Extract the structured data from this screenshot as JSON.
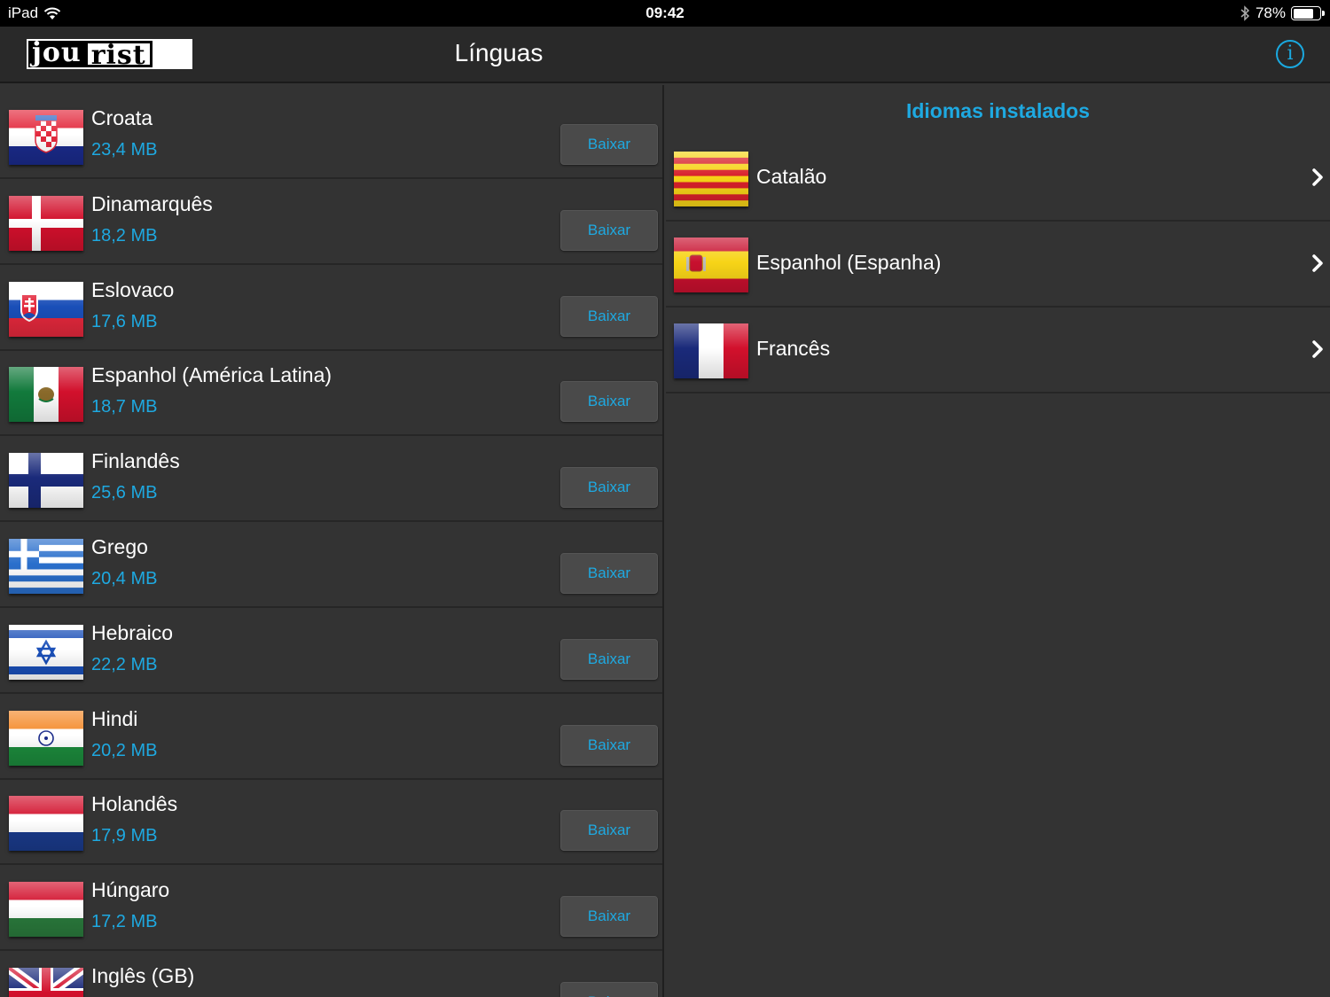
{
  "status_bar": {
    "device": "iPad",
    "time": "09:42",
    "battery": "78%",
    "battery_level": 0.78
  },
  "nav": {
    "logo_left": "jou",
    "logo_right": "rist",
    "title": "Línguas",
    "info_icon": "info-icon"
  },
  "available": {
    "button_label": "Baixar",
    "items": [
      {
        "name": "Croata",
        "size": "23,4 MB",
        "flag": "croatia"
      },
      {
        "name": "Dinamarquês",
        "size": "18,2 MB",
        "flag": "denmark"
      },
      {
        "name": "Eslovaco",
        "size": "17,6 MB",
        "flag": "slovakia"
      },
      {
        "name": "Espanhol (América Latina)",
        "size": "18,7 MB",
        "flag": "mexico"
      },
      {
        "name": "Finlandês",
        "size": "25,6 MB",
        "flag": "finland"
      },
      {
        "name": "Grego",
        "size": "20,4 MB",
        "flag": "greece"
      },
      {
        "name": "Hebraico",
        "size": "22,2 MB",
        "flag": "israel"
      },
      {
        "name": "Hindi",
        "size": "20,2 MB",
        "flag": "india"
      },
      {
        "name": "Holandês",
        "size": "17,9 MB",
        "flag": "netherlands"
      },
      {
        "name": "Húngaro",
        "size": "17,2 MB",
        "flag": "hungary"
      },
      {
        "name": "Inglês (GB)",
        "size": "",
        "flag": "uk"
      }
    ]
  },
  "installed": {
    "title": "Idiomas instalados",
    "items": [
      {
        "name": "Catalão",
        "flag": "catalonia"
      },
      {
        "name": "Espanhol (Espanha)",
        "flag": "spain"
      },
      {
        "name": "Francês",
        "flag": "france"
      }
    ]
  },
  "colors": {
    "accent": "#1ea9e1",
    "background": "#333333",
    "navbar": "#292929"
  }
}
